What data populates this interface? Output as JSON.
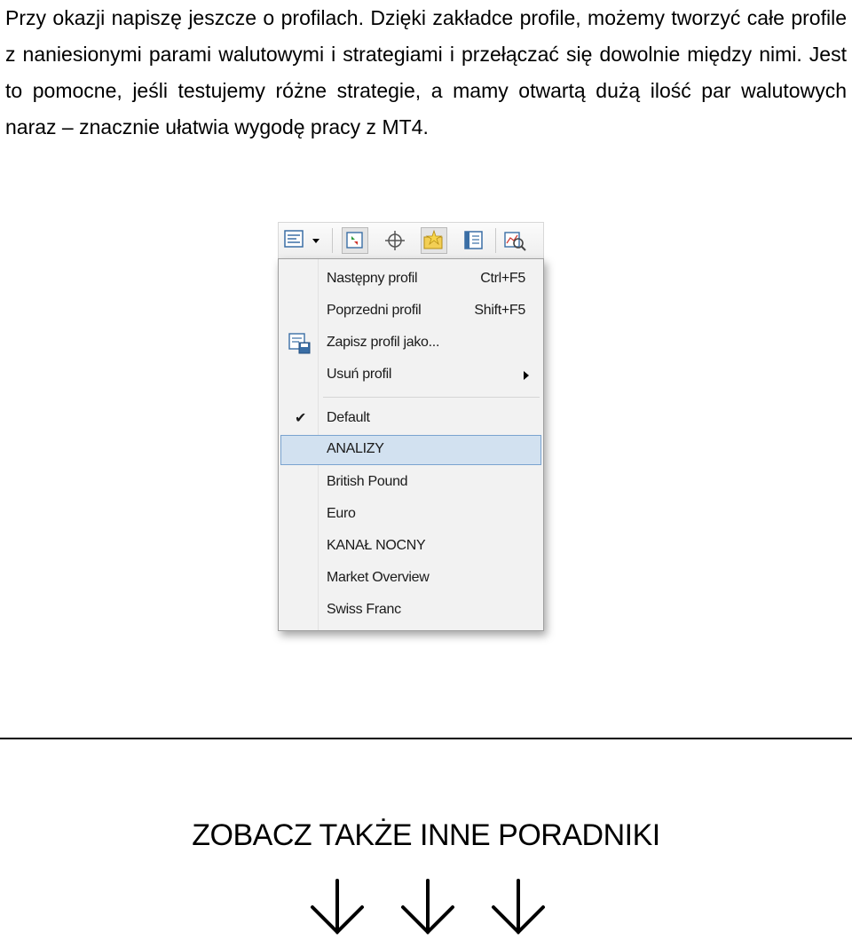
{
  "intro": {
    "line1": "Przy okazji napiszę jeszcze o profilach. Dzięki zakładce profile, możemy tworzyć całe profile z naniesionymi parami walutowymi i strategiami i przełączać się dowolnie między nimi. Jest to pomocne, jeśli testujemy różne strategie, a mamy otwartą dużą ilość par walutowych naraz – znacznie ułatwia wygodę pracy z MT4."
  },
  "toolbar": {
    "icons": [
      "profiles-icon",
      "dropdown-arrow-icon",
      "new-order-icon",
      "crosshair-icon",
      "favorites-icon",
      "navigator-icon",
      "strategy-tester-icon"
    ]
  },
  "menu": {
    "next": {
      "label": "Następny profil",
      "accel": "Ctrl+F5"
    },
    "prev": {
      "label": "Poprzedni profil",
      "accel": "Shift+F5"
    },
    "save": {
      "label": "Zapisz profil jako..."
    },
    "remove": {
      "label": "Usuń profil"
    },
    "profiles": [
      {
        "label": "Default",
        "checked": true
      },
      {
        "label": "ANALIZY",
        "highlighted": true
      },
      {
        "label": "British Pound"
      },
      {
        "label": "Euro"
      },
      {
        "label": "KANAŁ NOCNY"
      },
      {
        "label": "Market Overview"
      },
      {
        "label": "Swiss Franc"
      }
    ],
    "check_glyph": "✔"
  },
  "footer": {
    "heading": "ZOBACZ TAKŻE INNE PORADNIKI"
  },
  "colors": {
    "highlight_bg": "#d2e1f0",
    "highlight_border": "#7aa3cf"
  }
}
